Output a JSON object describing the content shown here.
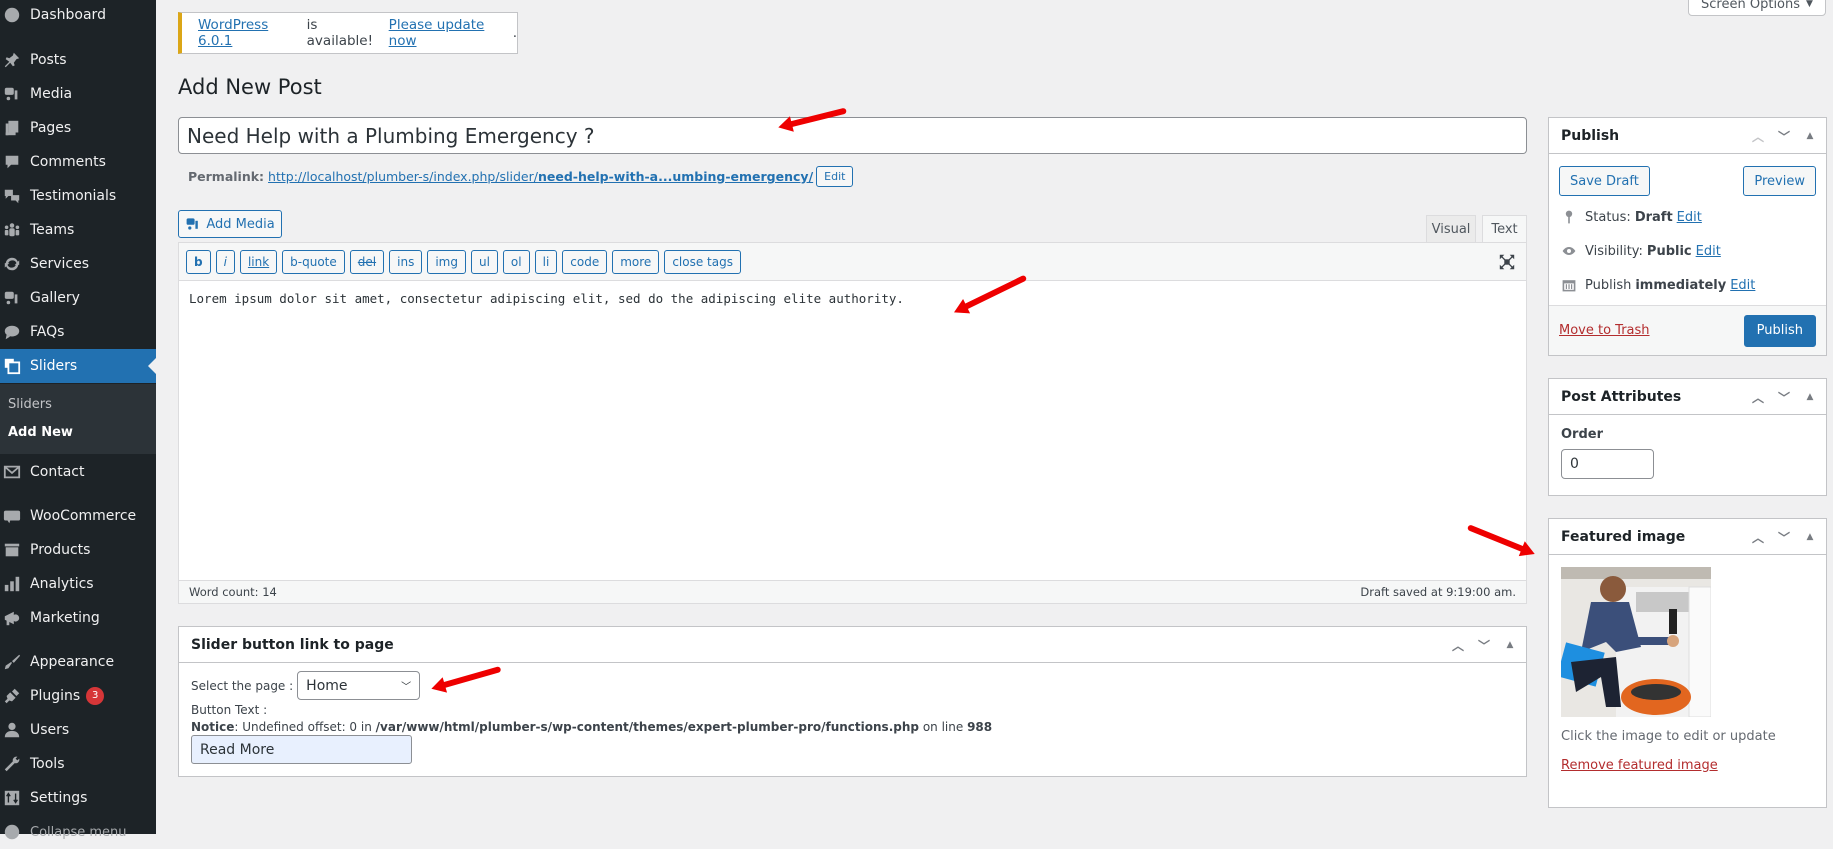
{
  "sidebar": {
    "items": [
      {
        "label": "Dashboard",
        "icon": "dashboard-icon"
      },
      {
        "label": "Posts",
        "icon": "pin-icon"
      },
      {
        "label": "Media",
        "icon": "media-icon"
      },
      {
        "label": "Pages",
        "icon": "pages-icon"
      },
      {
        "label": "Comments",
        "icon": "comment-icon"
      },
      {
        "label": "Testimonials",
        "icon": "testimonials-icon"
      },
      {
        "label": "Teams",
        "icon": "groups-icon"
      },
      {
        "label": "Services",
        "icon": "update-icon"
      },
      {
        "label": "Gallery",
        "icon": "media-icon"
      },
      {
        "label": "FAQs",
        "icon": "format-chat-icon"
      },
      {
        "label": "Sliders",
        "icon": "slides-icon",
        "active": true
      },
      {
        "label": "Contact",
        "icon": "email-icon"
      },
      {
        "label": "WooCommerce",
        "icon": "woo-icon"
      },
      {
        "label": "Products",
        "icon": "archive-icon"
      },
      {
        "label": "Analytics",
        "icon": "chart-bar-icon"
      },
      {
        "label": "Marketing",
        "icon": "megaphone-icon"
      },
      {
        "label": "Appearance",
        "icon": "brush-icon"
      },
      {
        "label": "Plugins",
        "icon": "plugin-icon",
        "badge": "3"
      },
      {
        "label": "Users",
        "icon": "user-icon"
      },
      {
        "label": "Tools",
        "icon": "wrench-icon"
      },
      {
        "label": "Settings",
        "icon": "settings-icon"
      },
      {
        "label": "Collapse menu",
        "icon": "collapse-icon"
      }
    ],
    "submenu": [
      {
        "label": "Sliders"
      },
      {
        "label": "Add New",
        "current": true
      }
    ]
  },
  "header": {
    "screen_options": "Screen Options"
  },
  "notice": {
    "link1": "WordPress 6.0.1",
    "middle": "is available!",
    "link2": "Please update now",
    "end": "."
  },
  "page_title": "Add New Post",
  "post": {
    "title": "Need Help with a Plumbing Emergency ?",
    "permalink_label": "Permalink:",
    "permalink_base": "http://localhost/plumber-s/index.php/slider/",
    "permalink_slug": "need-help-with-a...umbing-emergency/",
    "permalink_edit": "Edit"
  },
  "editor": {
    "add_media": "Add Media",
    "tabs": [
      "Visual",
      "Text"
    ],
    "active_tab": "Text",
    "quicktags": [
      "b",
      "i",
      "link",
      "b-quote",
      "del",
      "ins",
      "img",
      "ul",
      "ol",
      "li",
      "code",
      "more",
      "close tags"
    ],
    "content": "Lorem ipsum dolor sit amet, consectetur adipiscing elit, sed do the adipiscing elite authority.",
    "word_count": "Word count: 14",
    "draft_saved": "Draft saved at 9:19:00 am."
  },
  "slider_box": {
    "title": "Slider button link to page",
    "select_label": "Select the page :",
    "select_value": "Home",
    "button_text_label": "Button Text :",
    "notice_label": "Notice",
    "notice_text": ": Undefined offset: 0 in",
    "notice_path": "/var/www/html/plumber-s/wp-content/themes/expert-plumber-pro/functions.php",
    "notice_online": "on line",
    "notice_line": "988",
    "button_text_value": "Read More"
  },
  "publish": {
    "title": "Publish",
    "save_draft": "Save Draft",
    "preview": "Preview",
    "status_label": "Status:",
    "status_value": "Draft",
    "visibility_label": "Visibility:",
    "visibility_value": "Public",
    "publish_label": "Publish",
    "publish_value": "immediately",
    "edit": "Edit",
    "trash": "Move to Trash",
    "publish_button": "Publish"
  },
  "attributes": {
    "title": "Post Attributes",
    "order_label": "Order",
    "order_value": "0"
  },
  "featured": {
    "title": "Featured image",
    "caption": "Click the image to edit or update",
    "remove": "Remove featured image"
  },
  "colors": {
    "accent": "#2271b1",
    "sidebar_bg": "#1d2327",
    "danger": "#b32d2e",
    "notice_border": "#dba617",
    "annotation_arrow": "#ee0000"
  }
}
